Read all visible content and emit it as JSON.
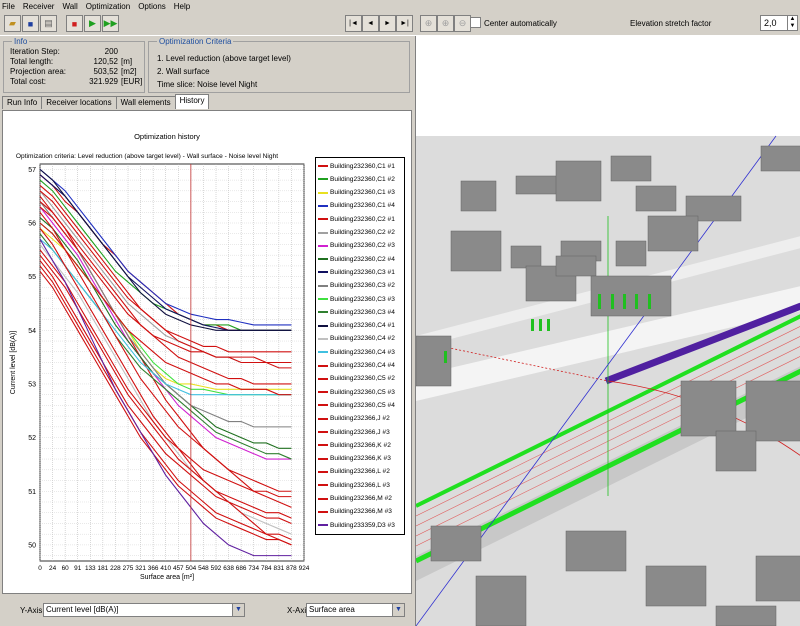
{
  "menu": [
    "File",
    "Receiver",
    "Wall",
    "Optimization",
    "Options",
    "Help"
  ],
  "toolbar": {
    "center_automatically": "Center automatically",
    "elevation_label": "Elevation stretch factor",
    "elevation_value": "2,0",
    "nav_first": "|◄",
    "nav_prev": "◄",
    "nav_next": "►",
    "nav_last": "►|"
  },
  "info": {
    "title": "Info",
    "rows": [
      {
        "k": "Iteration Step:",
        "v": "200",
        "u": ""
      },
      {
        "k": "Total length:",
        "v": "120,52",
        "u": "[m]"
      },
      {
        "k": "Projection area:",
        "v": "503,52",
        "u": "[m2]"
      },
      {
        "k": "Total cost:",
        "v": "321.929",
        "u": "[EUR]"
      }
    ]
  },
  "criteria": {
    "title": "Optimization Criteria",
    "items": [
      "1. Level reduction (above target level)",
      "2. Wall surface",
      "Time slice: Noise level Night"
    ]
  },
  "tabs": [
    "Run Info",
    "Receiver locations",
    "Wall elements",
    "History"
  ],
  "chart_data": {
    "type": "line",
    "title": "Optimization history",
    "subtitle": "Optimization criteria: Level reduction (above target level) - Wall surface - Noise level Night",
    "xlabel": "Surface area [m²]",
    "ylabel": "Current level [dB(A)]",
    "x_ticks": [
      "0",
      "24",
      "60",
      "91",
      "133",
      "181",
      "228",
      "275",
      "321",
      "366",
      "410",
      "457",
      "504",
      "548",
      "592",
      "638",
      "686",
      "734",
      "784",
      "831",
      "878",
      "924"
    ],
    "y_ticks": [
      50,
      51,
      52,
      53,
      54,
      55,
      56,
      57
    ],
    "ylim": [
      49.7,
      57.1
    ],
    "marker_x_index": 12,
    "grid": true,
    "series": [
      {
        "name": "Building232360,C1 #1",
        "color": "#d01010",
        "values": [
          56.9,
          56.7,
          56.4,
          56.2,
          55.9,
          55.6,
          55.4,
          55.1,
          54.9,
          54.7,
          54.5,
          54.3,
          54.2,
          54.1,
          54.1,
          54.0,
          54.0,
          54.0,
          54.0,
          54.0,
          54.0
        ]
      },
      {
        "name": "Building232360,C1 #2",
        "color": "#20a020",
        "values": [
          56.8,
          56.6,
          56.3,
          56.0,
          55.7,
          55.4,
          55.1,
          54.9,
          54.7,
          54.5,
          54.4,
          54.3,
          54.2,
          54.1,
          54.1,
          54.1,
          54.0,
          54.0,
          54.0,
          54.0,
          54.0
        ]
      },
      {
        "name": "Building232360,C1 #3",
        "color": "#e8e020",
        "values": [
          55.9,
          55.7,
          55.5,
          55.2,
          54.9,
          54.6,
          54.3,
          54.0,
          53.6,
          53.3,
          53.1,
          53.0,
          53.0,
          52.95,
          52.9,
          52.9,
          52.9,
          52.9,
          52.9,
          52.9,
          52.9
        ]
      },
      {
        "name": "Building232360,C1 #4",
        "color": "#2030c0",
        "values": [
          57.0,
          56.8,
          56.6,
          56.3,
          56.0,
          55.7,
          55.4,
          55.1,
          54.9,
          54.7,
          54.5,
          54.4,
          54.3,
          54.25,
          54.2,
          54.2,
          54.15,
          54.1,
          54.1,
          54.1,
          54.1
        ]
      },
      {
        "name": "Building232360,C2 #1",
        "color": "#d01010",
        "values": [
          56.5,
          56.2,
          55.9,
          55.5,
          55.1,
          54.7,
          54.3,
          53.9,
          53.5,
          53.1,
          52.7,
          52.4,
          52.1,
          51.8,
          51.6,
          51.4,
          51.2,
          51.0,
          50.9,
          50.8,
          50.7
        ]
      },
      {
        "name": "Building232360,C2 #2",
        "color": "#a0a0a0",
        "values": [
          56.6,
          56.3,
          56.0,
          55.7,
          55.4,
          55.1,
          54.8,
          54.5,
          54.3,
          54.1,
          53.9,
          53.8,
          53.7,
          53.6,
          53.5,
          53.5,
          53.4,
          53.4,
          53.4,
          53.4,
          53.4
        ]
      },
      {
        "name": "Building232360,C2 #3",
        "color": "#d020d0",
        "values": [
          56.3,
          56.0,
          55.7,
          55.4,
          55.0,
          54.6,
          54.2,
          53.8,
          53.5,
          53.2,
          52.9,
          52.6,
          52.4,
          52.2,
          52.0,
          51.9,
          51.8,
          51.7,
          51.6,
          51.6,
          51.6
        ]
      },
      {
        "name": "Building232360,C2 #4",
        "color": "#207020",
        "values": [
          56.1,
          55.9,
          55.6,
          55.3,
          54.9,
          54.5,
          54.1,
          53.8,
          53.5,
          53.2,
          53.0,
          52.8,
          52.6,
          52.4,
          52.2,
          52.1,
          52.0,
          51.9,
          51.9,
          51.8,
          51.8
        ]
      },
      {
        "name": "Building232360,C3 #1",
        "color": "#101060",
        "values": [
          56.9,
          56.7,
          56.5,
          56.2,
          55.9,
          55.6,
          55.3,
          55.0,
          54.8,
          54.6,
          54.4,
          54.3,
          54.2,
          54.1,
          54.05,
          54.0,
          54.0,
          54.0,
          54.0,
          54.0,
          54.0
        ]
      },
      {
        "name": "Building232360,C3 #2",
        "color": "#808080",
        "values": [
          56.4,
          56.1,
          55.8,
          55.5,
          55.1,
          54.7,
          54.3,
          53.9,
          53.6,
          53.3,
          53.0,
          52.8,
          52.6,
          52.5,
          52.4,
          52.3,
          52.3,
          52.2,
          52.2,
          52.2,
          52.2
        ]
      },
      {
        "name": "Building232360,C3 #3",
        "color": "#40e040",
        "values": [
          56.0,
          55.8,
          55.5,
          55.2,
          54.9,
          54.6,
          54.3,
          54.0,
          53.7,
          53.4,
          53.2,
          53.0,
          52.9,
          52.9,
          52.85,
          52.8,
          52.8,
          52.8,
          52.8,
          52.8,
          52.8
        ]
      },
      {
        "name": "Building232360,C3 #4",
        "color": "#308030",
        "values": [
          55.8,
          55.5,
          55.2,
          54.9,
          54.6,
          54.3,
          53.9,
          53.6,
          53.3,
          53.1,
          52.9,
          52.7,
          52.5,
          52.3,
          52.1,
          52.0,
          51.9,
          51.8,
          51.7,
          51.7,
          51.6
        ]
      },
      {
        "name": "Building232360,C4 #1",
        "color": "#101040",
        "values": [
          57.0,
          56.8,
          56.5,
          56.2,
          55.9,
          55.6,
          55.3,
          55.0,
          54.7,
          54.5,
          54.3,
          54.2,
          54.1,
          54.05,
          54.0,
          54.0,
          54.0,
          54.0,
          54.0,
          54.0,
          54.0
        ]
      },
      {
        "name": "Building232360,C4 #2",
        "color": "#c0c0c0",
        "values": [
          55.6,
          55.3,
          55.0,
          54.7,
          54.3,
          53.9,
          53.5,
          53.1,
          52.7,
          52.3,
          52.0,
          51.7,
          51.4,
          51.2,
          51.0,
          50.8,
          50.6,
          50.5,
          50.4,
          50.3,
          50.2
        ]
      },
      {
        "name": "Building232360,C4 #3",
        "color": "#40c0e0",
        "values": [
          55.7,
          55.5,
          55.2,
          54.9,
          54.6,
          54.3,
          54.0,
          53.7,
          53.4,
          53.2,
          53.0,
          52.9,
          52.8,
          52.8,
          52.8,
          52.8,
          52.8,
          52.8,
          52.8,
          52.8,
          52.8
        ]
      },
      {
        "name": "Building232360,C4 #4",
        "color": "#d01010",
        "values": [
          56.2,
          55.9,
          55.5,
          55.1,
          54.7,
          54.3,
          53.9,
          53.5,
          53.1,
          52.8,
          52.5,
          52.2,
          52.0,
          51.8,
          51.6,
          51.4,
          51.3,
          51.2,
          51.1,
          51.0,
          51.0
        ]
      },
      {
        "name": "Building232360,C5 #2",
        "color": "#d01010",
        "values": [
          55.9,
          55.6,
          55.2,
          54.8,
          54.4,
          54.0,
          53.6,
          53.2,
          52.8,
          52.4,
          52.1,
          51.8,
          51.5,
          51.2,
          51.0,
          50.8,
          50.6,
          50.4,
          50.2,
          50.1,
          50.0
        ]
      },
      {
        "name": "Building232360,C5 #3",
        "color": "#d01010",
        "values": [
          56.7,
          56.5,
          56.2,
          55.9,
          55.6,
          55.3,
          55.0,
          54.7,
          54.4,
          54.2,
          54.0,
          53.8,
          53.7,
          53.6,
          53.5,
          53.5,
          53.4,
          53.4,
          53.4,
          53.3,
          53.3
        ]
      },
      {
        "name": "Building232360,C5 #4",
        "color": "#d01010",
        "values": [
          55.4,
          55.1,
          54.8,
          54.4,
          54.0,
          53.6,
          53.2,
          52.8,
          52.5,
          52.2,
          51.9,
          51.6,
          51.4,
          51.2,
          51.0,
          50.9,
          50.8,
          50.7,
          50.6,
          50.6,
          50.5
        ]
      },
      {
        "name": "Building232366,J #2",
        "color": "#d01010",
        "values": [
          56.0,
          55.8,
          55.5,
          55.2,
          54.9,
          54.6,
          54.3,
          54.0,
          53.8,
          53.6,
          53.4,
          53.3,
          53.2,
          53.1,
          53.0,
          53.0,
          52.9,
          52.9,
          52.9,
          52.8,
          52.8
        ]
      },
      {
        "name": "Building232366,J #3",
        "color": "#d01010",
        "values": [
          55.2,
          54.9,
          54.5,
          54.1,
          53.7,
          53.3,
          52.9,
          52.5,
          52.1,
          51.8,
          51.5,
          51.2,
          51.0,
          50.8,
          50.6,
          50.5,
          50.4,
          50.3,
          50.2,
          50.2,
          50.1
        ]
      },
      {
        "name": "Building232366,K #2",
        "color": "#d01010",
        "values": [
          56.6,
          56.4,
          56.1,
          55.8,
          55.5,
          55.2,
          54.9,
          54.6,
          54.4,
          54.2,
          54.0,
          53.9,
          53.8,
          53.7,
          53.7,
          53.6,
          53.6,
          53.6,
          53.6,
          53.6,
          53.6
        ]
      },
      {
        "name": "Building232366,K #3",
        "color": "#d01010",
        "values": [
          55.5,
          55.2,
          54.9,
          54.5,
          54.1,
          53.7,
          53.3,
          52.9,
          52.6,
          52.3,
          52.0,
          51.8,
          51.6,
          51.4,
          51.3,
          51.2,
          51.1,
          51.0,
          51.0,
          50.9,
          50.9
        ]
      },
      {
        "name": "Building232366,L #2",
        "color": "#d01010",
        "values": [
          56.4,
          56.2,
          55.9,
          55.6,
          55.3,
          55.0,
          54.7,
          54.4,
          54.1,
          53.9,
          53.7,
          53.5,
          53.4,
          53.3,
          53.2,
          53.1,
          53.1,
          53.0,
          53.0,
          53.0,
          53.0
        ]
      },
      {
        "name": "Building232366,L #3",
        "color": "#d01010",
        "values": [
          55.3,
          55.0,
          54.6,
          54.2,
          53.8,
          53.4,
          53.0,
          52.6,
          52.3,
          52.0,
          51.7,
          51.5,
          51.3,
          51.1,
          50.9,
          50.8,
          50.7,
          50.6,
          50.5,
          50.5,
          50.4
        ]
      },
      {
        "name": "Building232366,M #2",
        "color": "#d01010",
        "values": [
          56.3,
          56.1,
          55.8,
          55.5,
          55.2,
          54.9,
          54.6,
          54.3,
          54.1,
          53.9,
          53.8,
          53.7,
          53.6,
          53.6,
          53.5,
          53.5,
          53.5,
          53.5,
          53.4,
          53.4,
          53.4
        ]
      },
      {
        "name": "Building232366,M #3",
        "color": "#d01010",
        "values": [
          55.1,
          54.8,
          54.4,
          54.0,
          53.6,
          53.2,
          52.8,
          52.4,
          52.0,
          51.7,
          51.4,
          51.1,
          50.9,
          50.7,
          50.5,
          50.4,
          50.3,
          50.2,
          50.1,
          50.1,
          50.0
        ]
      },
      {
        "name": "Building233359,D3 #3",
        "color": "#6020a0",
        "values": [
          55.7,
          55.3,
          54.9,
          54.4,
          53.9,
          53.4,
          52.9,
          52.5,
          52.1,
          51.7,
          51.3,
          51.0,
          50.7,
          50.4,
          50.2,
          50.0,
          49.9,
          49.8,
          49.8,
          49.8,
          49.8
        ]
      }
    ]
  },
  "bottom": {
    "y_axis_label": "Y-Axis",
    "y_axis_value": "Current level [dB(A)]",
    "x_axis_label": "X-Axis",
    "x_axis_value": "Surface area"
  }
}
